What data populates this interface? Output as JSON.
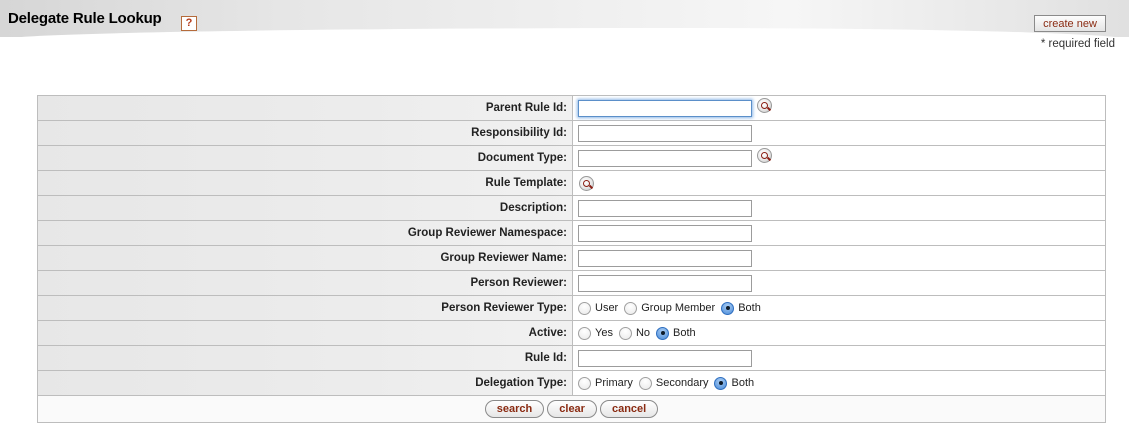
{
  "header": {
    "title": "Delegate Rule Lookup",
    "help_icon_glyph": "?",
    "create_new_label": "create new",
    "required_note": "* required field"
  },
  "form": {
    "fields": [
      {
        "label": "Parent Rule Id:",
        "type": "text",
        "value": "",
        "focused": true,
        "lookup": true
      },
      {
        "label": "Responsibility Id:",
        "type": "text",
        "value": ""
      },
      {
        "label": "Document Type:",
        "type": "text",
        "value": "",
        "lookup": true
      },
      {
        "label": "Rule Template:",
        "type": "lookup-only"
      },
      {
        "label": "Description:",
        "type": "text",
        "value": ""
      },
      {
        "label": "Group Reviewer Namespace:",
        "type": "text",
        "value": ""
      },
      {
        "label": "Group Reviewer Name:",
        "type": "text",
        "value": ""
      },
      {
        "label": "Person Reviewer:",
        "type": "text",
        "value": ""
      },
      {
        "label": "Person Reviewer Type:",
        "type": "radio",
        "options": [
          "User",
          "Group Member",
          "Both"
        ],
        "selected": "Both"
      },
      {
        "label": "Active:",
        "type": "radio",
        "options": [
          "Yes",
          "No",
          "Both"
        ],
        "selected": "Both"
      },
      {
        "label": "Rule Id:",
        "type": "text",
        "value": ""
      },
      {
        "label": "Delegation Type:",
        "type": "radio",
        "options": [
          "Primary",
          "Secondary",
          "Both"
        ],
        "selected": "Both"
      }
    ],
    "buttons": {
      "search": "search",
      "clear": "clear",
      "cancel": "cancel"
    }
  },
  "icons": {
    "lookup": "magnifier-lookup-icon",
    "help": "help-icon"
  },
  "colors": {
    "button_text": "#8a2b12",
    "focus_ring": "#8fb7e6",
    "radio_selected": "#4a8bd8"
  }
}
